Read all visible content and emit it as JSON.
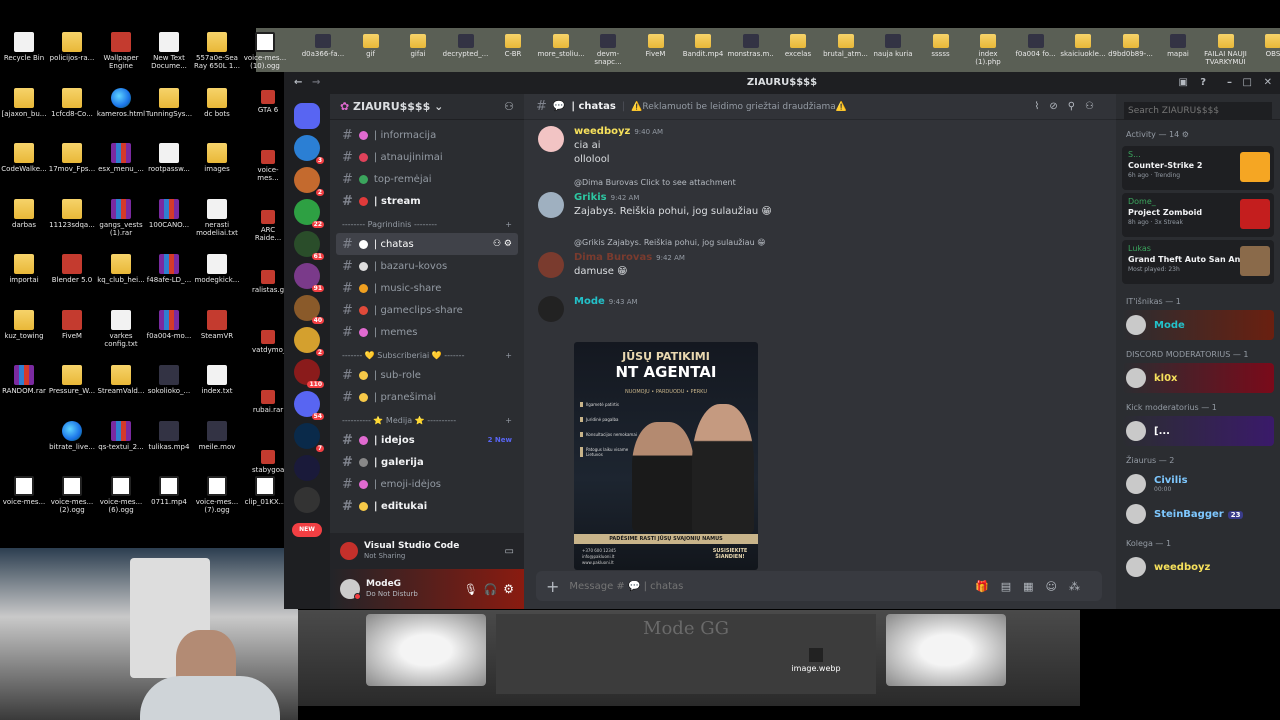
{
  "desktop": {
    "icons": [
      {
        "label": "Recycle Bin",
        "type": "file"
      },
      {
        "label": "policijos-ra...",
        "type": "folder"
      },
      {
        "label": "Wallpaper Engine",
        "type": "app"
      },
      {
        "label": "New Text Docume...",
        "type": "file"
      },
      {
        "label": "557a0e-Sea Ray 650L 1...",
        "type": "folder"
      },
      {
        "label": "voice-mes... (10).ogg",
        "type": "ogg"
      },
      {
        "label": "[ajaxon_bu...",
        "type": "folder"
      },
      {
        "label": "1cfcd8-Co...",
        "type": "folder"
      },
      {
        "label": "kameros.html",
        "type": "edge"
      },
      {
        "label": "TunningSys...",
        "type": "folder"
      },
      {
        "label": "dc bots",
        "type": "folder"
      },
      {
        "label": "CodeWalke...",
        "type": "folder"
      },
      {
        "label": "17mov_Fps...",
        "type": "folder"
      },
      {
        "label": "esx_menu_...",
        "type": "rar"
      },
      {
        "label": "rootpassw...",
        "type": "file"
      },
      {
        "label": "images",
        "type": "folder"
      },
      {
        "label": "darbas",
        "type": "folder"
      },
      {
        "label": "11123sdqa...",
        "type": "folder"
      },
      {
        "label": "gangs_vests (1).rar",
        "type": "rar"
      },
      {
        "label": "100CANO...",
        "type": "rar"
      },
      {
        "label": "nerasti modeliai.txt",
        "type": "file"
      },
      {
        "label": "importai",
        "type": "folder"
      },
      {
        "label": "Blender 5.0",
        "type": "app"
      },
      {
        "label": "kq_club_hei...",
        "type": "folder"
      },
      {
        "label": "f48afe-LD_...",
        "type": "rar"
      },
      {
        "label": "modegkick...",
        "type": "file"
      },
      {
        "label": "kuz_towing",
        "type": "folder"
      },
      {
        "label": "FiveM",
        "type": "app"
      },
      {
        "label": "varkes config.txt",
        "type": "file"
      },
      {
        "label": "f0a004-mo...",
        "type": "rar"
      },
      {
        "label": "SteamVR",
        "type": "app"
      },
      {
        "label": "RANDOM.rar",
        "type": "rar"
      },
      {
        "label": "Pressure_W...",
        "type": "folder"
      },
      {
        "label": "StreamVald...",
        "type": "folder"
      },
      {
        "label": "sokolioko_...",
        "type": "vid"
      },
      {
        "label": "index.txt",
        "type": "file"
      },
      {
        "label": "bitrate_live...",
        "type": "edge"
      },
      {
        "label": "qs-textui_2...",
        "type": "rar"
      },
      {
        "label": "tulikas.mp4",
        "type": "vid"
      },
      {
        "label": "meile.mov",
        "type": "vid"
      },
      {
        "label": "voice-mes...",
        "type": "ogg"
      },
      {
        "label": "voice-mes... (2).ogg",
        "type": "ogg"
      },
      {
        "label": "voice-mes... (6).ogg",
        "type": "ogg"
      },
      {
        "label": "0711.mp4",
        "type": "ogg"
      },
      {
        "label": "voice-mes... (7).ogg",
        "type": "ogg"
      },
      {
        "label": "clip_01KX...",
        "type": "ogg"
      }
    ],
    "top_icons": [
      "d0a366-fa...",
      "gif",
      "gifai",
      "decrypted_...",
      "C-BR",
      "more_stoliu...",
      "devm-snapc...",
      "FiveM",
      "Bandit.mp4",
      "monstras.m...",
      "excelas",
      "brutal_atm...",
      "nauja kuria",
      "sssss",
      "index (1).php",
      "f0a004 fo...",
      "skaiciuokle...",
      "d9bd0b89-...",
      "mapai",
      "FAILAI NAUJI TVARKYMUI",
      "OBS"
    ],
    "right_icons": [
      "GTA 6",
      "voice-mes...",
      "ARC Raide...",
      "ralistas.gif",
      "vatdymo_g...",
      "rubai.rar",
      "stabygoal"
    ],
    "photo_file": "image.webp",
    "photo_text": "Mode GG"
  },
  "discord": {
    "window_title": "ZIAURU$$$$",
    "server_name": "ZIAURU$$$$",
    "guild_badges": [
      "3",
      "2",
      "22",
      "61",
      "91",
      "40",
      "2",
      "110",
      "54",
      "7"
    ],
    "new_label": "NEW",
    "channels_top": [
      {
        "name": "| informacija",
        "icon": "#e06ad0"
      },
      {
        "name": "| atnaujinimai",
        "icon": "#e0425a"
      },
      {
        "name": "top-remėjai",
        "icon": "#3ba55d"
      },
      {
        "name": "| stream",
        "icon": "#e03a3a",
        "bold": true
      }
    ],
    "cat1": "-------- Pagrindinis --------",
    "channels_main": [
      {
        "name": "| chatas",
        "icon": "#ffffff",
        "active": true
      },
      {
        "name": "| bazaru-kovos",
        "icon": "#dddddd"
      },
      {
        "name": "| music-share",
        "icon": "#f0a020"
      },
      {
        "name": "| gameclips-share",
        "icon": "#e04a3a"
      },
      {
        "name": "| memes",
        "icon": "#e06ad0"
      }
    ],
    "cat2": "------- 💛 Subscriberiai 💛 -------",
    "channels_sub": [
      {
        "name": "| sub-role",
        "icon": "#f7c948"
      },
      {
        "name": "| pranešimai",
        "icon": "#f7c948"
      }
    ],
    "cat3": "---------- ⭐ Medija ⭐ ----------",
    "channels_media": [
      {
        "name": "| idejos",
        "icon": "#e06ad0",
        "bold": true,
        "badge": "2 New"
      },
      {
        "name": "| galerija",
        "icon": "#888888",
        "bold": true
      },
      {
        "name": "| emoji-idėjos",
        "icon": "#e06ad0"
      },
      {
        "name": "| editukai",
        "icon": "#f7c948",
        "bold": true
      }
    ],
    "activity": {
      "title": "Visual Studio Code",
      "sub": "Not Sharing"
    },
    "user": {
      "name": "ModeG",
      "status": "Do Not Disturb"
    },
    "chat_header": {
      "channel": "| chatas",
      "topic": "⚠️Reklamuoti be leidimo griežtai draudžiama⚠️"
    },
    "messages": [
      {
        "author": "weedboyz",
        "time": "9:40 AM",
        "color": "#f7e15c",
        "lines": [
          "cia ai",
          "ollolool"
        ]
      },
      {
        "reply": "@Dima Burovas Click to see attachment",
        "author": "Grikis",
        "time": "9:42 AM",
        "color": "#2dc7a2",
        "lines": [
          "Zajabys. Reiškia pohui, jog sulaužiau 😁"
        ]
      },
      {
        "reply": "@Grikis Zajabys. Reiškia pohui, jog sulaužiau 😁",
        "author": "Dima Burovas",
        "time": "9:42 AM",
        "color": "#7a3b2e",
        "lines": [
          "damuse 😁"
        ]
      },
      {
        "author": "Mode",
        "time": "9:43 AM",
        "color": "#23c1c9",
        "lines": []
      }
    ],
    "poster": {
      "top": "JŪSŲ PATIKIMI",
      "headline": "NT AGENTAI",
      "services": "NUOMOJU • PARDUODU • PERKU",
      "bullets": [
        "Ilgametė patirtis",
        "Juridinė pagalba",
        "Konsultacijos nemokamai",
        "Patogus laiku visame Lietuvos"
      ],
      "slogan": "PADĖSIME RASTI JŪSŲ SVAJONIŲ NAMUS",
      "phone": "+370 600 12345",
      "email": "info@pakluoni.lt",
      "site": "www.pakluoni.lt",
      "cta": "SUSISIEKITE ŠIANDIEN!"
    },
    "composer_placeholder": "Message # 💬 | chatas",
    "search_placeholder": "Search ZIAURU$$$$",
    "members": {
      "activity_header": "Activity — 14 ⚙",
      "cards": [
        {
          "user": "S...",
          "game": "Counter-Strike 2",
          "meta": "6h ago · Trending",
          "thumb": "#f5a623"
        },
        {
          "user": "Dome_",
          "game": "Project Zomboid",
          "meta": "8h ago · 3x Streak",
          "thumb": "#c41e1e"
        },
        {
          "user": "Lukas",
          "game": "Grand Theft Auto San Andr...",
          "meta": "Most played: 23h",
          "thumb": "#8a6a4a"
        }
      ],
      "groups": [
        {
          "header": "IT'išnikas — 1",
          "members": [
            {
              "name": "Mode",
              "color": "#23c1c9",
              "bg": "#6a2010"
            }
          ]
        },
        {
          "header": "DISCORD MODERATORIUS — 1",
          "members": [
            {
              "name": "kl0x",
              "color": "#f7e15c",
              "bg": "#7a0a1a"
            }
          ]
        },
        {
          "header": "Kick moderatorius — 1",
          "members": [
            {
              "name": "[...",
              "color": "#ffffff",
              "bg": "#3a1a6a"
            }
          ]
        },
        {
          "header": "Žiaurus — 2",
          "members": [
            {
              "name": "Civilis",
              "color": "#7ec8ff",
              "sub": "00:00"
            },
            {
              "name": "SteinBagger",
              "color": "#7ec8ff",
              "badge": "23"
            }
          ]
        },
        {
          "header": "Kolega — 1",
          "members": [
            {
              "name": "weedboyz",
              "color": "#f7e15c"
            }
          ]
        }
      ]
    }
  }
}
